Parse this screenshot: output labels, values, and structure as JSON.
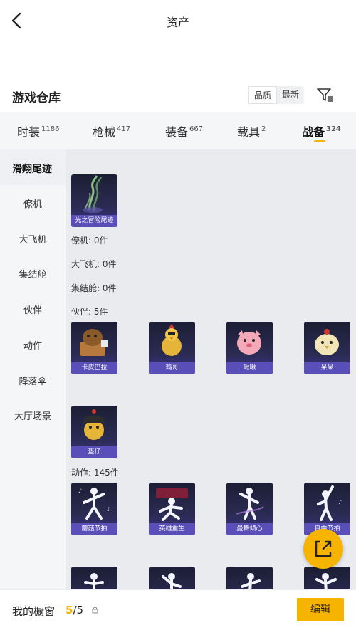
{
  "header": {
    "title": "资产"
  },
  "section": {
    "title": "游戏仓库",
    "sort": [
      "品质",
      "最新"
    ]
  },
  "tabs": [
    {
      "label": "时装",
      "count": "1186"
    },
    {
      "label": "枪械",
      "count": "417"
    },
    {
      "label": "装备",
      "count": "667"
    },
    {
      "label": "载具",
      "count": "2"
    },
    {
      "label": "战备",
      "count": "324"
    }
  ],
  "sidebar": [
    "滑翔尾迹",
    "僚机",
    "大飞机",
    "集结舱",
    "伙伴",
    "动作",
    "降落伞",
    "大厅场景"
  ],
  "groups": {
    "glide_item": "光之冒险尾迹",
    "wingman": "僚机: 0件",
    "plane": "大飞机: 0件",
    "capsule": "集结舱: 0件",
    "partner": "伙伴: 5件",
    "partner_items": [
      "卡皮巴拉",
      "鸡哥",
      "啾啾",
      "呆呆",
      "盔仔"
    ],
    "actions": "动作: 145件",
    "action_items": [
      "蘑菇节拍",
      "英雄重生",
      "曼舞倾心",
      "自由节拍"
    ]
  },
  "bottom": {
    "label": "我的橱窗",
    "current": "5",
    "total": "/5",
    "edit": "编辑"
  },
  "colors": {
    "accent": "#f6b300",
    "card_label": "#5a4fb8"
  }
}
